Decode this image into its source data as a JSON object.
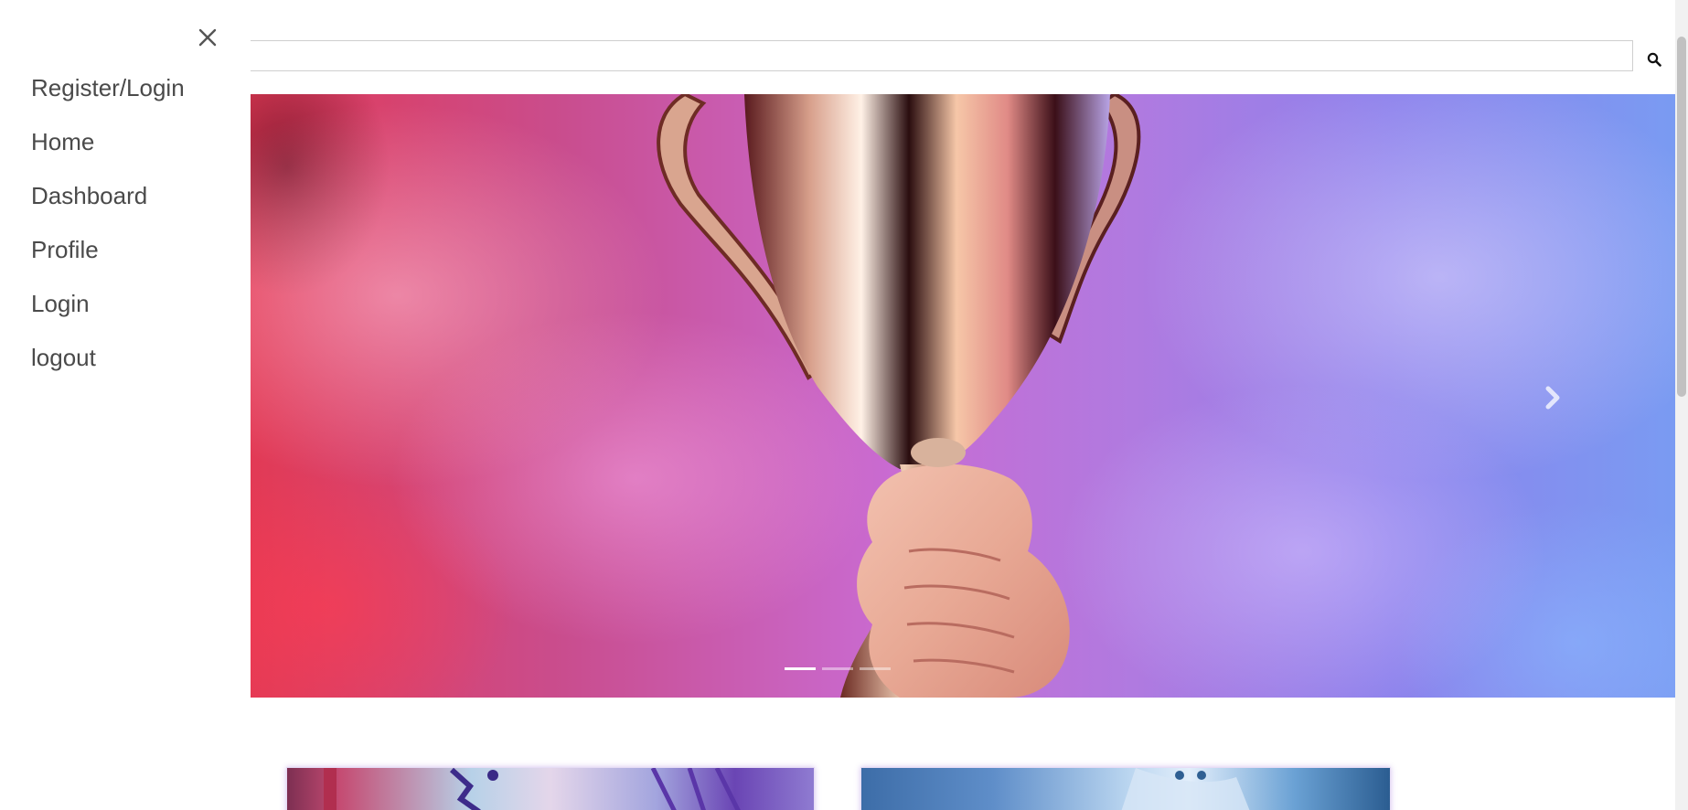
{
  "search": {
    "placeholder": "",
    "value": "",
    "button_icon": "search-icon"
  },
  "drawer": {
    "close_icon": "close-icon",
    "items": [
      {
        "label": "Register/Login"
      },
      {
        "label": "Home"
      },
      {
        "label": "Dashboard"
      },
      {
        "label": "Profile"
      },
      {
        "label": "Login"
      },
      {
        "label": "logout"
      }
    ]
  },
  "carousel": {
    "image": "trophy-in-hand-over-pink-purple-smoke",
    "next_icon": "chevron-right-icon",
    "slide_count": 3,
    "active_slide": 1
  },
  "cards": [
    {
      "image": "game-art-purple-runner"
    },
    {
      "image": "game-art-blue-anime-character"
    }
  ],
  "colors": {
    "drawer_text": "#4a4a4a",
    "search_border": "#cfcfcf",
    "indicator_active": "#ffffff"
  }
}
